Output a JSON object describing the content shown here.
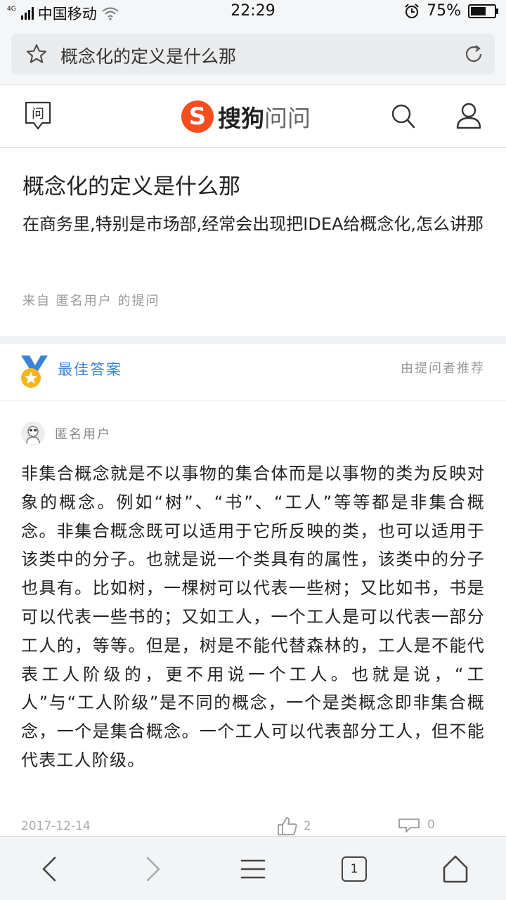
{
  "status_bar": {
    "network_tag": "4G",
    "carrier": "中国移动",
    "time": "22:29",
    "battery_percent": "75%",
    "battery_level": 0.75
  },
  "url_bar": {
    "text": "概念化的定义是什么那"
  },
  "header": {
    "logo_mark": "S",
    "logo_text_1": "搜狗",
    "logo_text_2": "问问",
    "ask_icon_char": "问"
  },
  "question": {
    "title": "概念化的定义是什么那",
    "description": "在商务里,特别是市场部,经常会出现把IDEA给概念化,怎么讲那",
    "meta": "来自  匿名用户  的提问"
  },
  "best_answer": {
    "label": "最佳答案",
    "recommended_by": "由提问者推荐"
  },
  "answer": {
    "user": "匿名用户",
    "body": "非集合概念就是不以事物的集合体而是以事物的类为反映对象的概念。例如“树”、“书”、“工人”等等都是非集合概念。非集合概念既可以适用于它所反映的类，也可以适用于该类中的分子。也就是说一个类具有的属性，该类中的分子也具有。比如树，一棵树可以代表一些树；又比如书，书是可以代表一些书的；又如工人，一个工人是可以代表一部分工人的，等等。但是，树是不能代替森林的，工人是不能代表工人阶级的，更不用说一个工人。也就是说，“工人”与“工人阶级”是不同的概念，一个是类概念即非集合概念，一个是集合概念。一个工人可以代表部分工人，但不能代表工人阶级。",
    "date": "2017-12-14",
    "likes": "2",
    "comments": "0"
  },
  "bottom_nav": {
    "tab_count": "1"
  }
}
